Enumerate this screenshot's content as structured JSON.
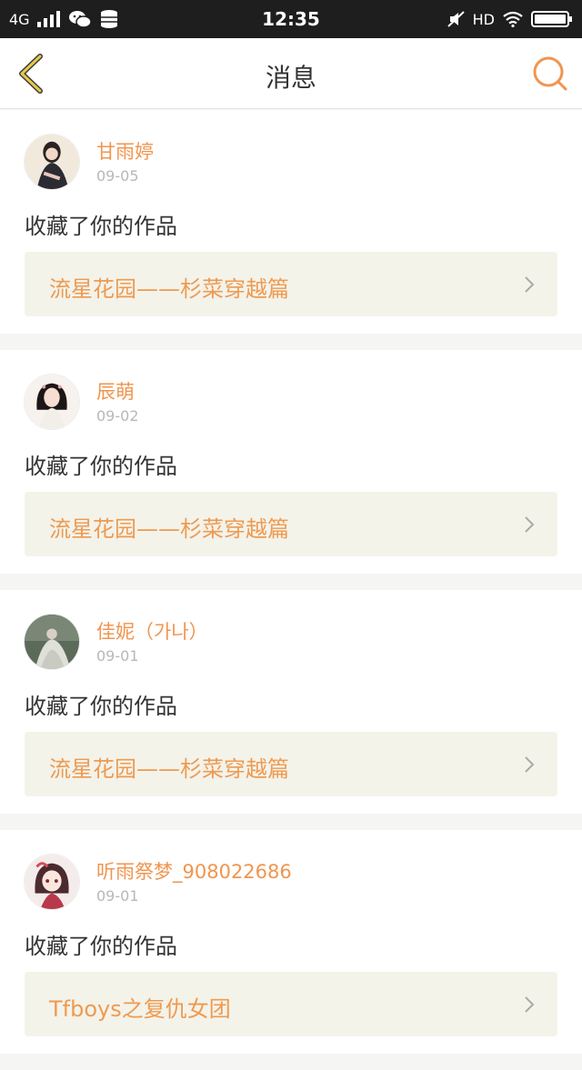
{
  "status_bar": {
    "network": "4G",
    "time": "12:35",
    "hd": "HD"
  },
  "nav": {
    "title": "消息"
  },
  "messages": [
    {
      "name": "甘雨婷",
      "date": "09-05",
      "action": "收藏了你的作品",
      "work": "流星花园——杉菜穿越篇"
    },
    {
      "name": "辰萌",
      "date": "09-02",
      "action": "收藏了你的作品",
      "work": "流星花园——杉菜穿越篇"
    },
    {
      "name": "佳妮（가나）",
      "date": "09-01",
      "action": "收藏了你的作品",
      "work": "流星花园——杉菜穿越篇"
    },
    {
      "name": "听雨祭梦_908022686",
      "date": "09-01",
      "action": "收藏了你的作品",
      "work": "Tfboys之复仇女团"
    }
  ],
  "colors": {
    "accent": "#f0954f",
    "back_arrow": "#e6c84a",
    "card_link_bg": "#f3f3ea"
  }
}
